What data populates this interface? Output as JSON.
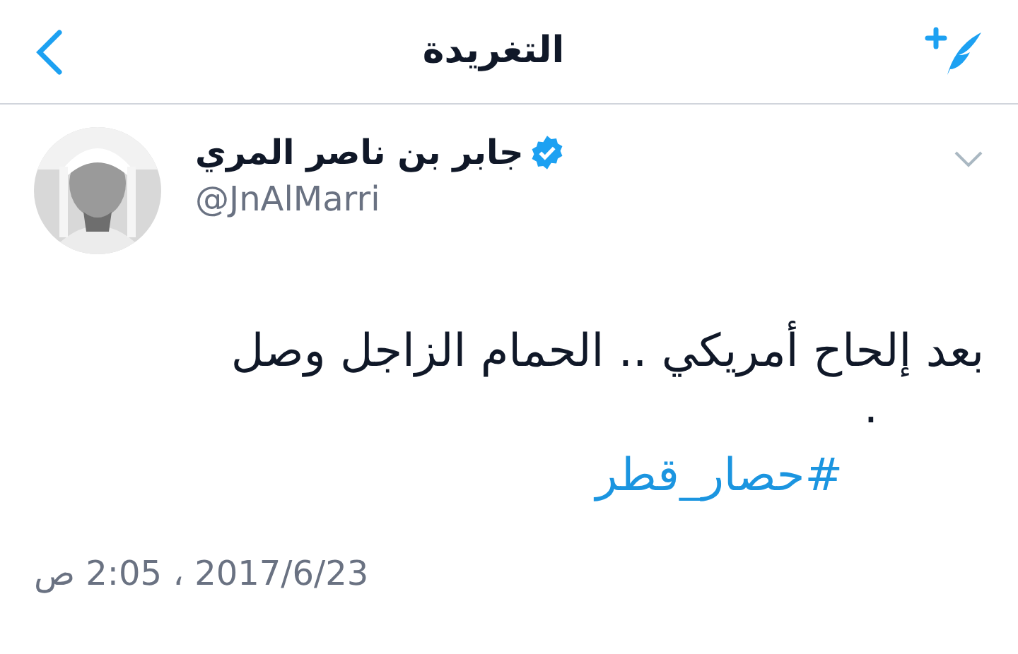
{
  "header": {
    "title": "التغريدة"
  },
  "tweet": {
    "author": {
      "name": "جابر بن ناصر المري",
      "verified": true,
      "handle": "@JnAlMarri"
    },
    "text": "بعد إلحاح أمريكي .. الحمام الزاجل وصل",
    "text_end": ".",
    "hashtag": "#حصار_قطر",
    "timestamp": "2017/6/23 ، 2:05 ص"
  }
}
